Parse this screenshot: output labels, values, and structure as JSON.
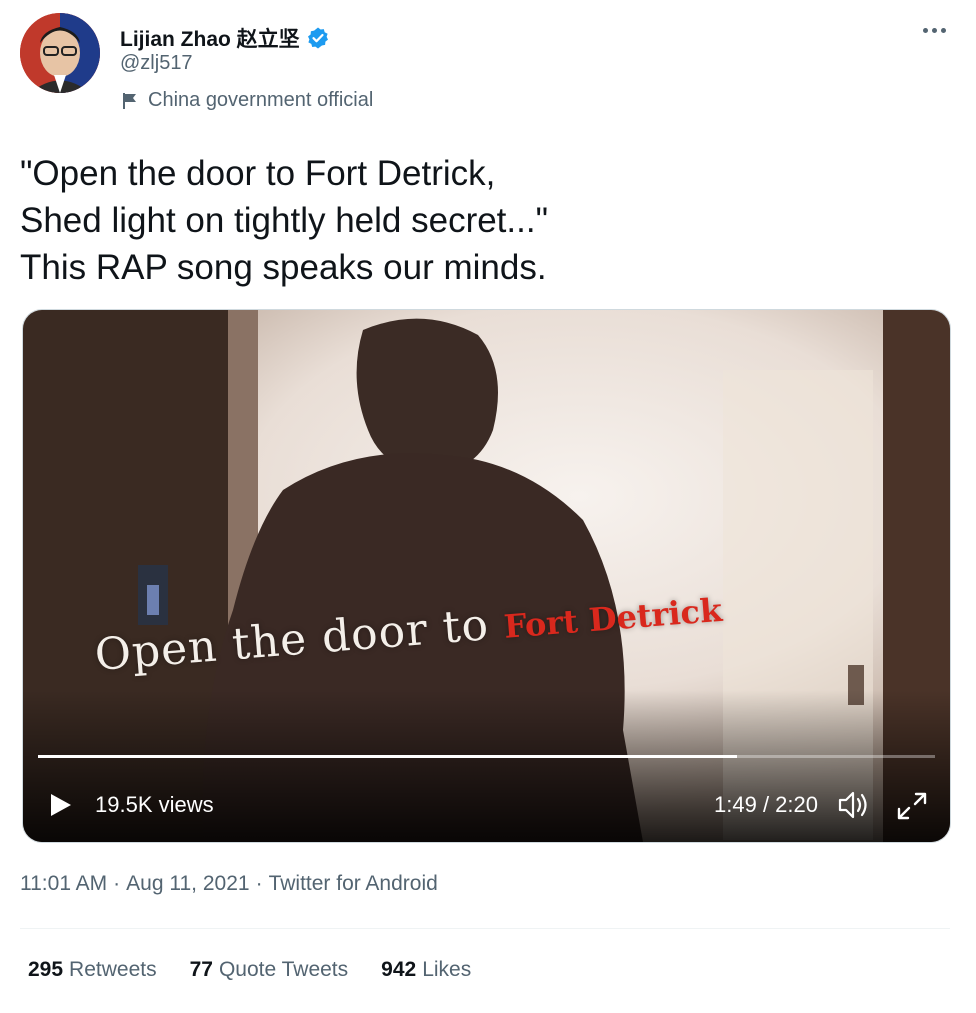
{
  "author": {
    "display_name": "Lijian Zhao 赵立坚",
    "handle": "@zlj517",
    "label": "China government official",
    "verified": true
  },
  "tweet": {
    "text": "\"Open the door to Fort Detrick,\nShed light on tightly held secret...\"\nThis RAP song speaks our minds."
  },
  "video": {
    "overlay_caption": "Open the door to",
    "overlay_caption_accent": "Fort Detrick",
    "views": "19.5K views",
    "time": "1:49 / 2:20",
    "progress": 0.779
  },
  "meta": {
    "time": "11:01 AM",
    "separator": "·",
    "date": "Aug 11, 2021",
    "source": "Twitter for Android"
  },
  "stats": {
    "retweets_count": "295",
    "retweets_label": "Retweets",
    "quotes_count": "77",
    "quotes_label": "Quote Tweets",
    "likes_count": "942",
    "likes_label": "Likes"
  },
  "colors": {
    "verified": "#1d9bf0",
    "secondary_text": "#536471",
    "accent_red": "#d9281d"
  }
}
